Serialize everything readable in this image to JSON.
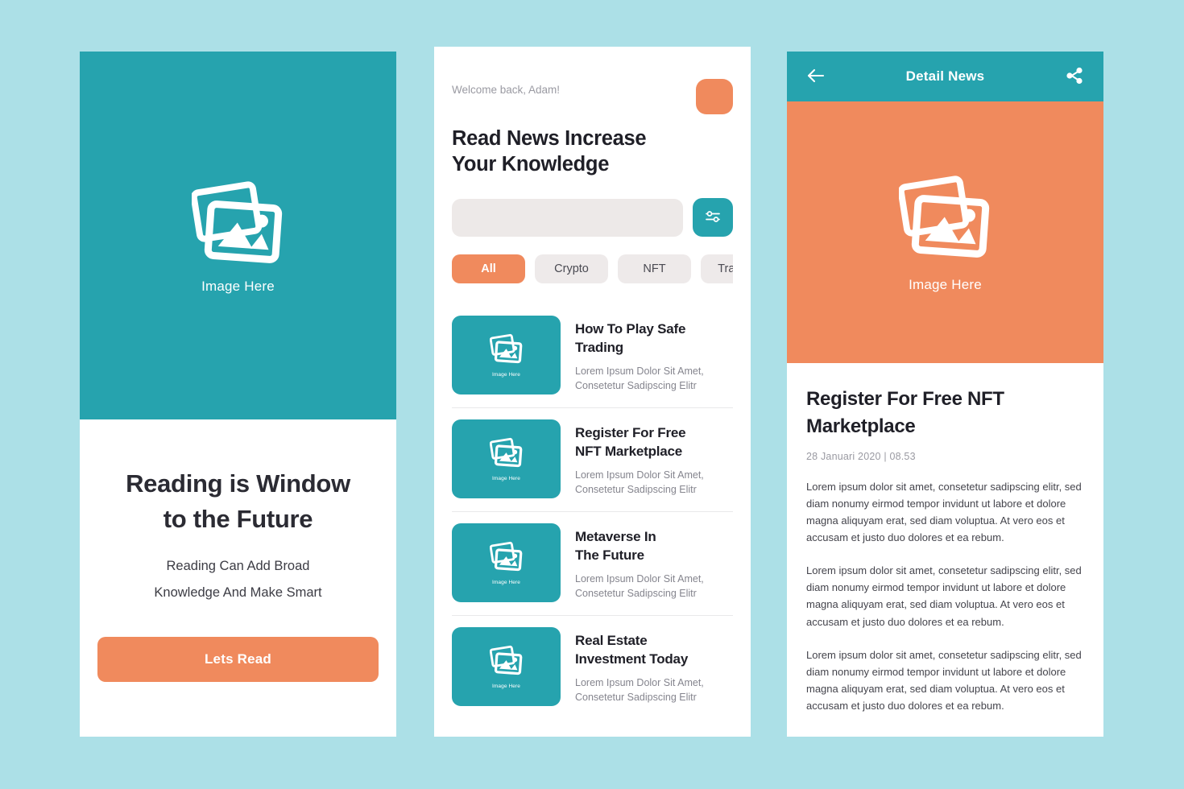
{
  "theme": {
    "background": "#ace0e7",
    "teal": "#26a3ae",
    "orange": "#f08a5d",
    "text_dark": "#1f1f27",
    "text_muted": "#9a9aa2",
    "field_gray": "#ede9e8",
    "chip_gray": "#eeeaea"
  },
  "onboarding": {
    "image_placeholder_label": "Image Here",
    "title_line1": "Reading is Window",
    "title_line2": "to the Future",
    "subtitle_line1": "Reading Can Add Broad",
    "subtitle_line2": "Knowledge And Make Smart",
    "cta_label": "Lets Read"
  },
  "home": {
    "welcome": "Welcome back, Adam!",
    "heading_line1": "Read News Increase",
    "heading_line2": "Your Knowledge",
    "search": {
      "value": "",
      "placeholder": ""
    },
    "filter_icon": "sliders-icon",
    "chips": [
      {
        "label": "All",
        "active": true
      },
      {
        "label": "Crypto",
        "active": false
      },
      {
        "label": "NFT",
        "active": false
      },
      {
        "label": "Trading",
        "active": false
      }
    ],
    "thumb_label": "Image Here",
    "news": [
      {
        "title_line1": "How To Play Safe",
        "title_line2": "Trading",
        "desc_line1": "Lorem Ipsum Dolor Sit Amet,",
        "desc_line2": "Consetetur Sadipscing Elitr"
      },
      {
        "title_line1": "Register For Free",
        "title_line2": "NFT Marketplace",
        "desc_line1": "Lorem Ipsum Dolor Sit Amet,",
        "desc_line2": "Consetetur Sadipscing Elitr"
      },
      {
        "title_line1": "Metaverse In",
        "title_line2": "The Future",
        "desc_line1": "Lorem Ipsum Dolor Sit Amet,",
        "desc_line2": "Consetetur Sadipscing Elitr"
      },
      {
        "title_line1": "Real Estate",
        "title_line2": "Investment Today",
        "desc_line1": "Lorem Ipsum Dolor Sit Amet,",
        "desc_line2": "Consetetur Sadipscing Elitr"
      }
    ]
  },
  "detail": {
    "appbar": {
      "back_icon": "arrow-left-icon",
      "title": "Detail News",
      "share_icon": "share-icon"
    },
    "image_placeholder_label": "Image Here",
    "title_line1": "Register For Free NFT",
    "title_line2": "Marketplace",
    "meta": "28  Januari 2020   |   08.53",
    "paragraphs": [
      "Lorem ipsum dolor sit amet, consetetur sadipscing elitr, sed diam nonumy eirmod tempor invidunt ut labore et dolore magna aliquyam erat, sed diam voluptua. At vero eos et accusam et justo duo dolores et ea rebum.",
      "Lorem ipsum dolor sit amet, consetetur sadipscing elitr, sed diam nonumy eirmod tempor invidunt ut labore et dolore magna aliquyam erat, sed diam voluptua. At vero eos et accusam et justo duo dolores et ea rebum.",
      "Lorem ipsum dolor sit amet, consetetur sadipscing elitr, sed diam nonumy eirmod tempor invidunt ut labore et dolore magna aliquyam erat, sed diam voluptua. At vero eos et accusam et justo duo dolores et ea rebum."
    ]
  }
}
